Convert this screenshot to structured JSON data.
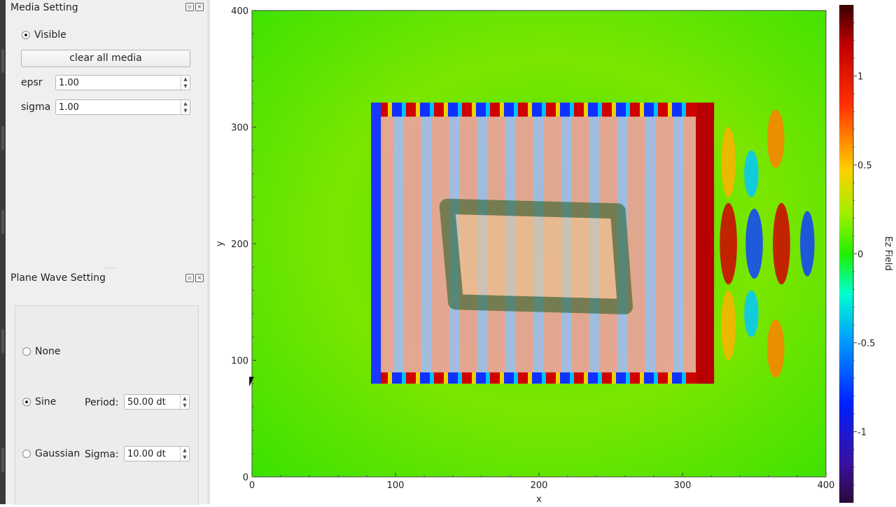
{
  "media_panel": {
    "title": "Media Setting",
    "visible_label": "Visible",
    "visible_checked": true,
    "clear_button": "clear all media",
    "epsr_label": "epsr",
    "epsr_value": "1.00",
    "sigma_label": "sigma",
    "sigma_value": "1.00"
  },
  "plane_wave_panel": {
    "title": "Plane Wave Setting",
    "options": [
      {
        "label": "None",
        "checked": false
      },
      {
        "label": "Sine",
        "checked": true
      },
      {
        "label": "Gaussian",
        "checked": false
      }
    ],
    "period_label": "Period:",
    "period_value": "50.00 dt",
    "sigma_label": "Sigma:",
    "sigma_value": "10.00 dt"
  },
  "icons": {
    "float": "float-icon",
    "close": "close-icon",
    "cursor": "mouse-cursor-icon"
  },
  "chart_data": {
    "type": "heatmap",
    "title": "",
    "xlabel": "x",
    "ylabel": "y",
    "xlim": [
      0,
      400
    ],
    "ylim": [
      0,
      400
    ],
    "x_ticks": [
      "0",
      "100",
      "200",
      "300",
      "400"
    ],
    "y_ticks": [
      "0",
      "100",
      "200",
      "300",
      "400"
    ],
    "colorbar": {
      "label": "Ez Field",
      "range": [
        -1.4,
        1.4
      ],
      "ticks": [
        "1",
        "0.5",
        "0",
        "-0.5",
        "-1"
      ],
      "tick_values": [
        1,
        0.5,
        0,
        -0.5,
        -1
      ],
      "colormap": "jet"
    },
    "overlays": [
      {
        "name": "media-rectangle",
        "x": [
          83,
          322
        ],
        "y": [
          80,
          321
        ]
      },
      {
        "name": "media-inner-quad",
        "points": [
          [
            136,
            232
          ],
          [
            255,
            228
          ],
          [
            260,
            146
          ],
          [
            142,
            150
          ]
        ]
      }
    ],
    "grid": false
  }
}
